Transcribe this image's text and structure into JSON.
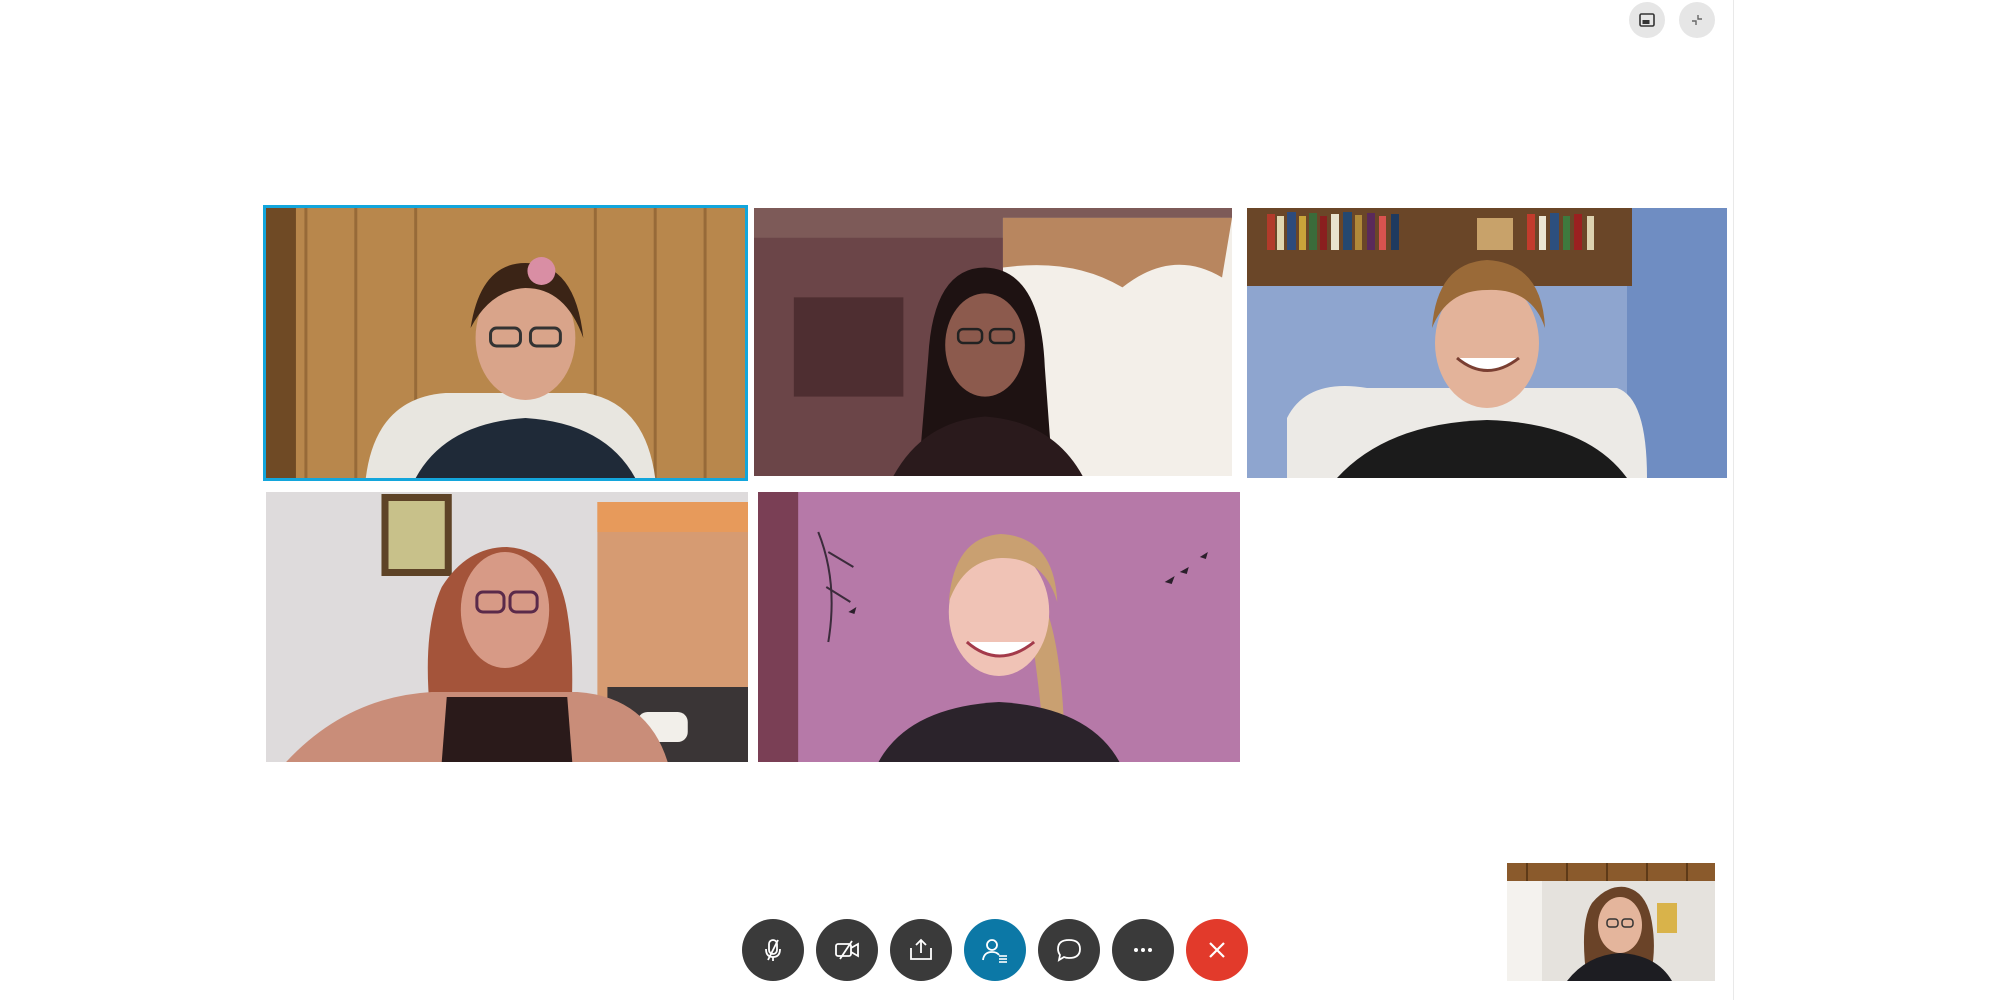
{
  "window": {
    "corner_buttons": [
      {
        "name": "pip-toggle",
        "icon": "picture-in-picture-icon"
      },
      {
        "name": "exit-fullscreen",
        "icon": "collapse-icon"
      }
    ]
  },
  "video_grid": {
    "participants": [
      {
        "position": "row1-col1",
        "active_speaker": true,
        "background": "wood-panel-wall"
      },
      {
        "position": "row1-col2",
        "active_speaker": false,
        "background": "dim-room-window"
      },
      {
        "position": "row1-col3",
        "active_speaker": false,
        "background": "blue-wall-bookshelf"
      },
      {
        "position": "row2-col1",
        "active_speaker": false,
        "background": "bright-room-curtain"
      },
      {
        "position": "row2-col2",
        "active_speaker": false,
        "background": "pink-wall-decals"
      }
    ]
  },
  "self_view": {
    "background": "wood-ceiling-room"
  },
  "call_controls": [
    {
      "name": "mute",
      "icon": "microphone-off-icon"
    },
    {
      "name": "camera",
      "icon": "video-off-icon"
    },
    {
      "name": "share",
      "icon": "share-icon"
    },
    {
      "name": "participants",
      "icon": "participants-icon",
      "highlighted": true
    },
    {
      "name": "chat",
      "icon": "chat-icon"
    },
    {
      "name": "more",
      "icon": "more-icon"
    },
    {
      "name": "hang-up",
      "icon": "hang-up-icon"
    }
  ],
  "colors": {
    "active_border": "#13a6dc",
    "control_bg": "#3a3a3a",
    "participants_bg": "#0c78a6",
    "hangup_bg": "#e23a2b"
  }
}
